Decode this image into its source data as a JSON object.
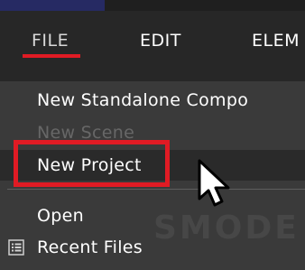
{
  "menubar": {
    "items": [
      {
        "label": "FILE",
        "active": true
      },
      {
        "label": "EDIT",
        "active": false
      },
      {
        "label": "ELEM",
        "active": false
      }
    ]
  },
  "file_menu": {
    "items": [
      {
        "label": "New Standalone Compo",
        "enabled": true
      },
      {
        "label": "New Scene",
        "enabled": false
      },
      {
        "label": "New Project",
        "enabled": true,
        "highlighted": true
      },
      {
        "label": "Open",
        "enabled": true
      },
      {
        "label": "Recent Files",
        "enabled": true,
        "icon": "list-icon"
      }
    ]
  },
  "watermark": {
    "text": "SMODE"
  },
  "colors": {
    "menubar_bg": "#272727",
    "dropdown_bg": "#3a3a3a",
    "highlight_red": "#e01b24",
    "disabled_text": "#676767",
    "top_accent": "#262a63"
  }
}
